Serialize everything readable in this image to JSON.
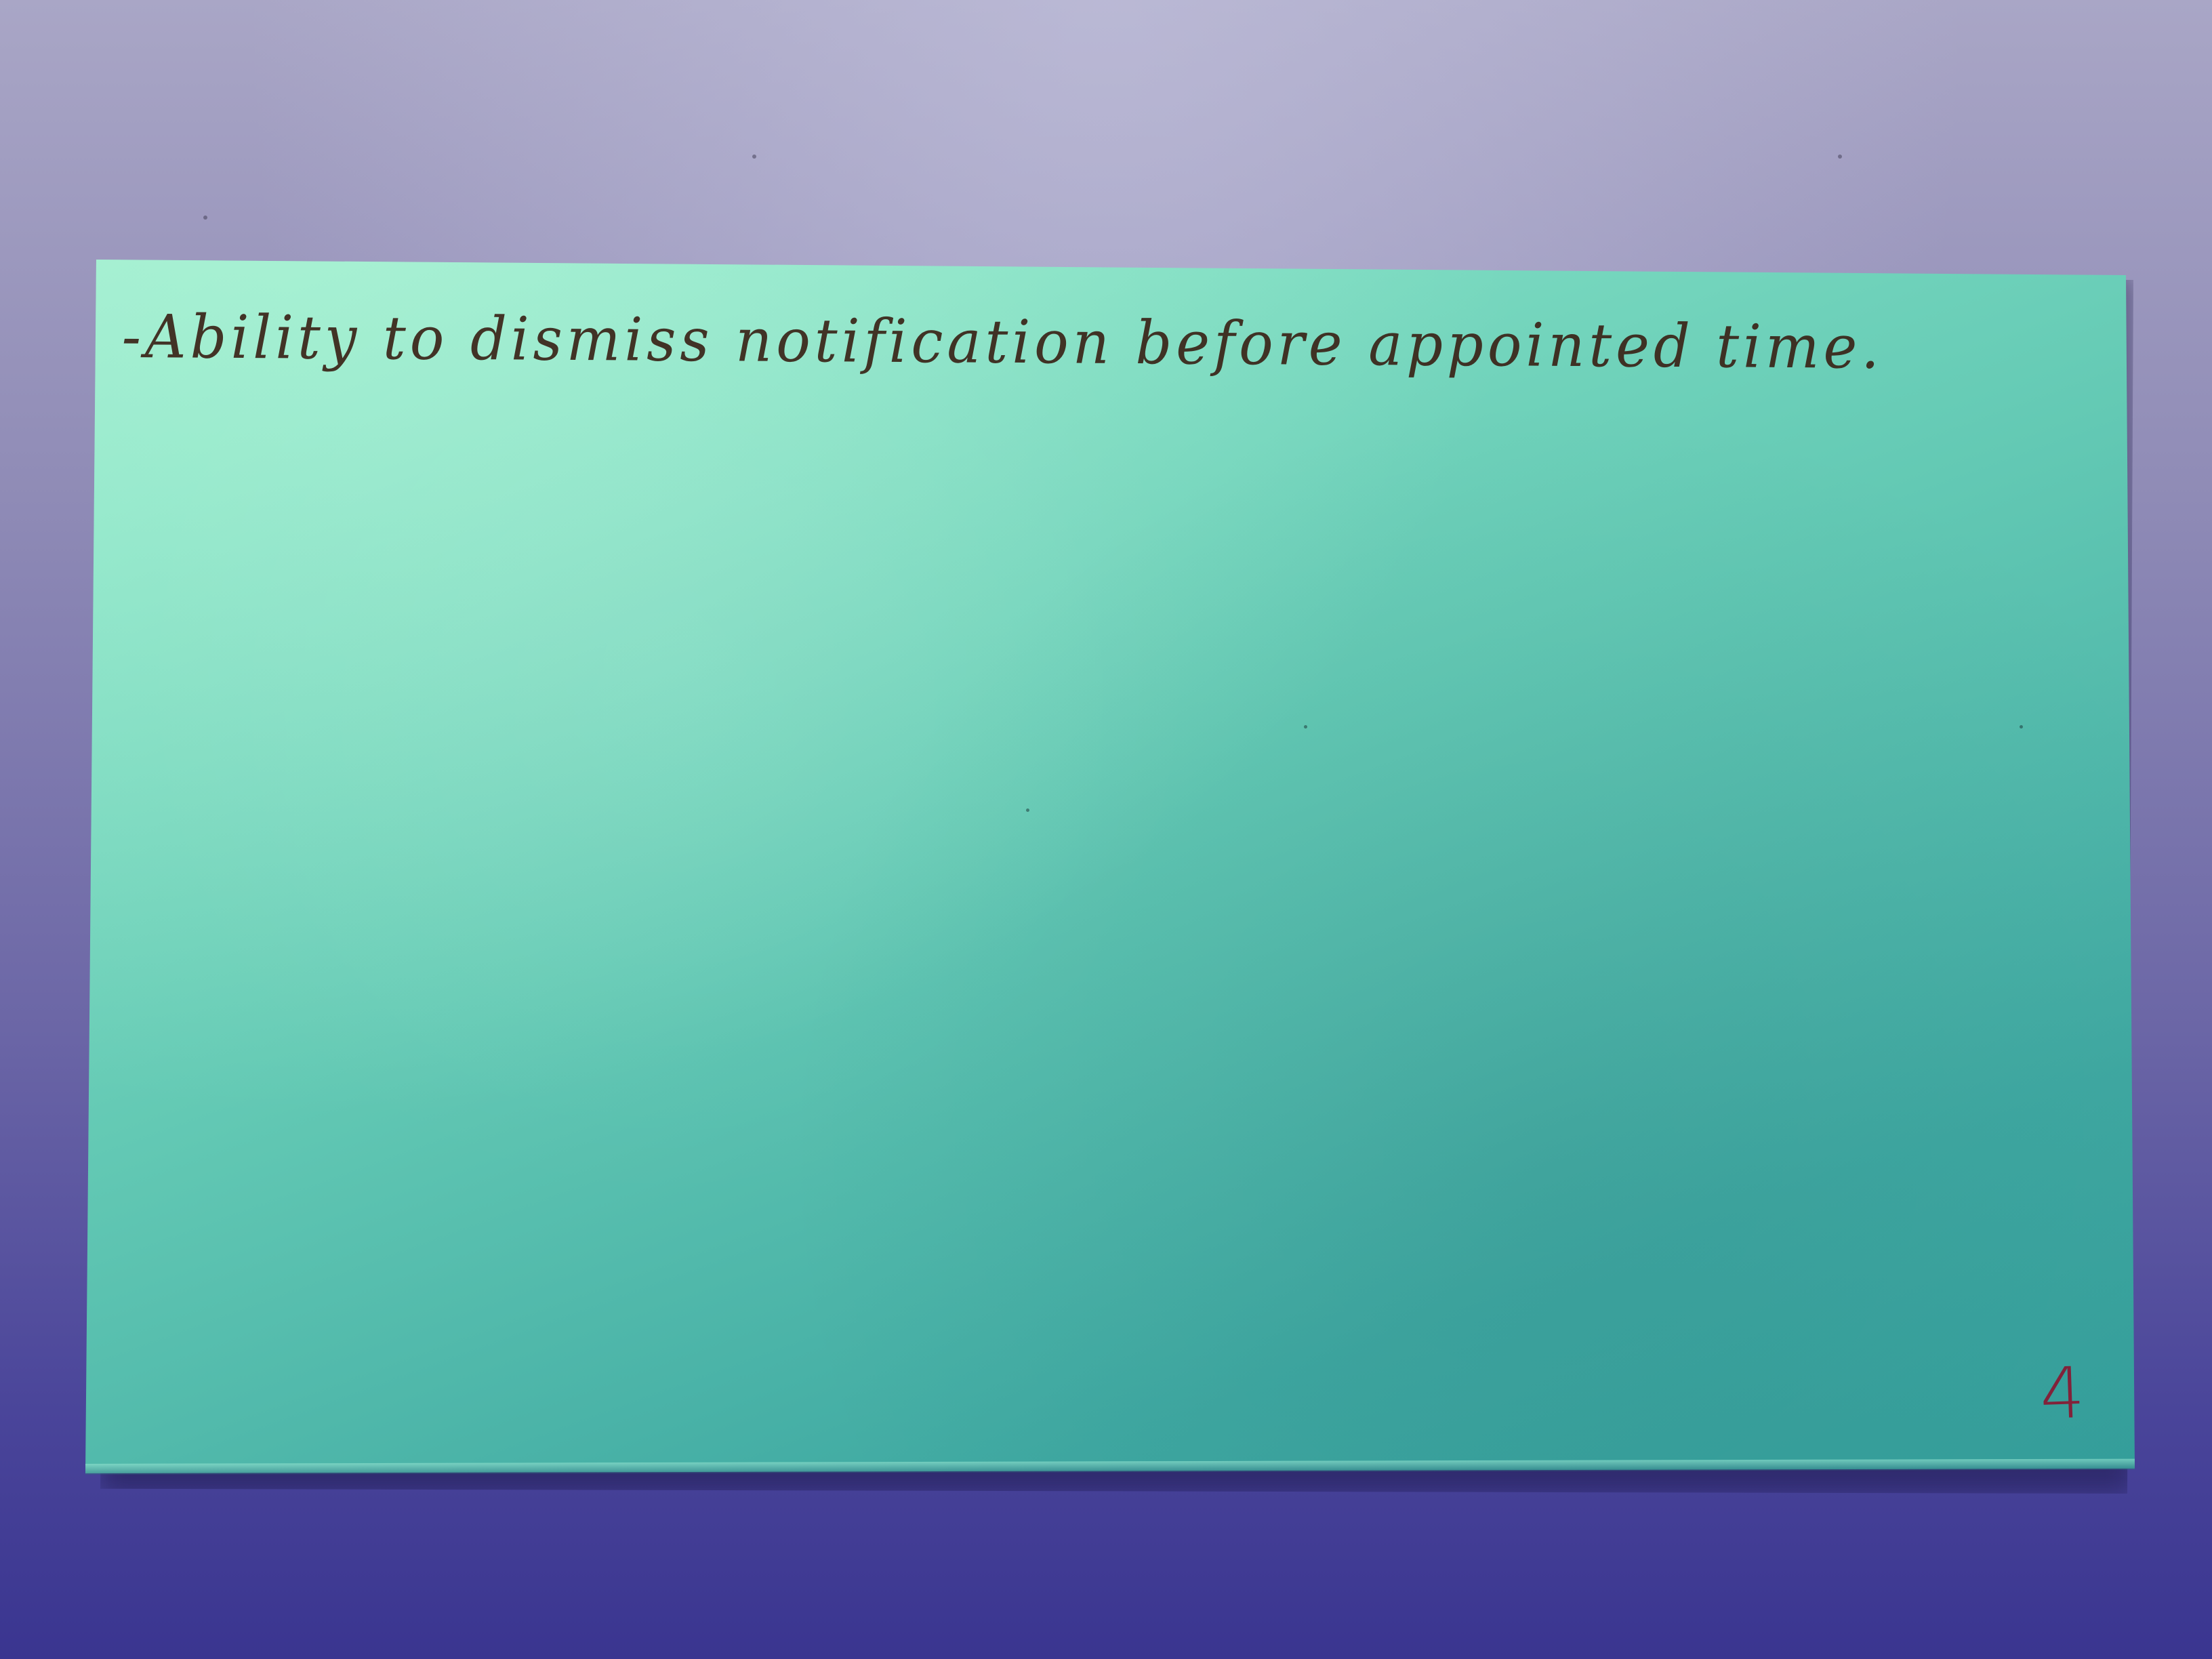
{
  "photo": {
    "subject": "index-card-photo",
    "background_color": "#7d79b0",
    "card_color": "#6fd3bb"
  },
  "card": {
    "note": "-Ability to dismiss notification before appointed time.",
    "number": "4",
    "note_color": "#3a2418",
    "number_color": "#8a1530"
  }
}
